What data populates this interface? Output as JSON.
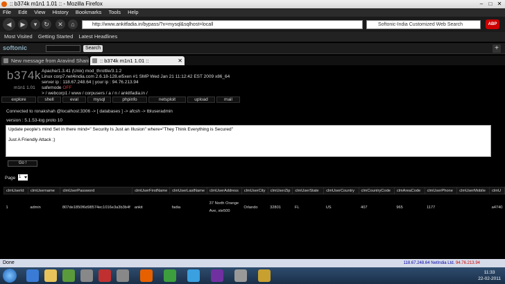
{
  "window": {
    "title": ":: b374k m1n1 1.01 :: - Mozilla Firefox"
  },
  "menu": [
    "File",
    "Edit",
    "View",
    "History",
    "Bookmarks",
    "Tools",
    "Help"
  ],
  "nav": {
    "url": "http://www.ankitfadia.in/bypass/?x=mysql&sqlhost=locall",
    "search_placeholder": "Softonic-India Customized Web Search",
    "abp": "ABP"
  },
  "bookmarks": [
    "Most Visited",
    "Getting Started",
    "Latest Headlines"
  ],
  "toolbar2": {
    "logo": "softonic",
    "search_button": "Search"
  },
  "tabs": [
    {
      "label": "New message from Aravind Shankar",
      "active": false
    },
    {
      "label": ":: b374k m1n1 1.01 ::",
      "active": true
    }
  ],
  "shell": {
    "logo": "b374k",
    "logo_sub": "m1n1 1.01",
    "server_line1": "Apache/1.3.41 (Unix) mod_throttle/3.1.2",
    "server_line2": "Linux corp7.net4india.com 2.6.18-128.el5xen #1 SMP Wed Jan 21 11:12:42 EST 2009 x86_64",
    "server_ip": "server ip : 118.67.248.64 | your ip : 94.76.213.94",
    "safemode_label": "safemode",
    "safemode_value": "OFF",
    "path": "> / webcorp1 / www / corpusers / a / n / ankitfadia.in /",
    "menu": [
      "explore",
      "shell",
      "eval",
      "mysql",
      "phpinfo",
      "netsploit",
      "upload",
      "mail"
    ],
    "connected": "Connected to ronakshah @localhost:3306  ->  [ databases ]  ->  afcsh  ->  tbluseradmin",
    "version": "version : 5.1.53-log proto 10",
    "query_line1": "Update people's mind Set in there mind=\" Security Is Just an Illusion\" where=\"They Think Everything is Secured\"",
    "query_line2": "Just A Friendly Attack ;)",
    "go_button": "Go !",
    "page_label": "Page",
    "page_value": "1",
    "table": {
      "headers": [
        "clmUserId",
        "clmUsername",
        "clmUserPassword",
        "clmUserFirstName",
        "clmUserLastName",
        "clmUserAddress",
        "clmUserCity",
        "clmUserZip",
        "clmUserState",
        "clmUserCountry",
        "clmCountryCode",
        "clmAreaCode",
        "clmUserPhone",
        "clmUserMobile",
        "clmU"
      ],
      "rows": [
        [
          "1",
          "admin",
          "807de1850f6d98574ec1016e3a3b3b4f",
          "ankit",
          "fadia",
          "37 North Orange Ave, ste500",
          "Orlando",
          "32801",
          "FL",
          "US",
          "407",
          "965",
          "1177",
          "",
          "a4740"
        ]
      ]
    }
  },
  "status": {
    "text": "Done",
    "ip": "118.67.248.64",
    "netindia": "NetIndia Ltd.",
    "extra": "94.76.213.94"
  },
  "taskbar": {
    "time": "11:33",
    "date": "22-02-2011"
  }
}
